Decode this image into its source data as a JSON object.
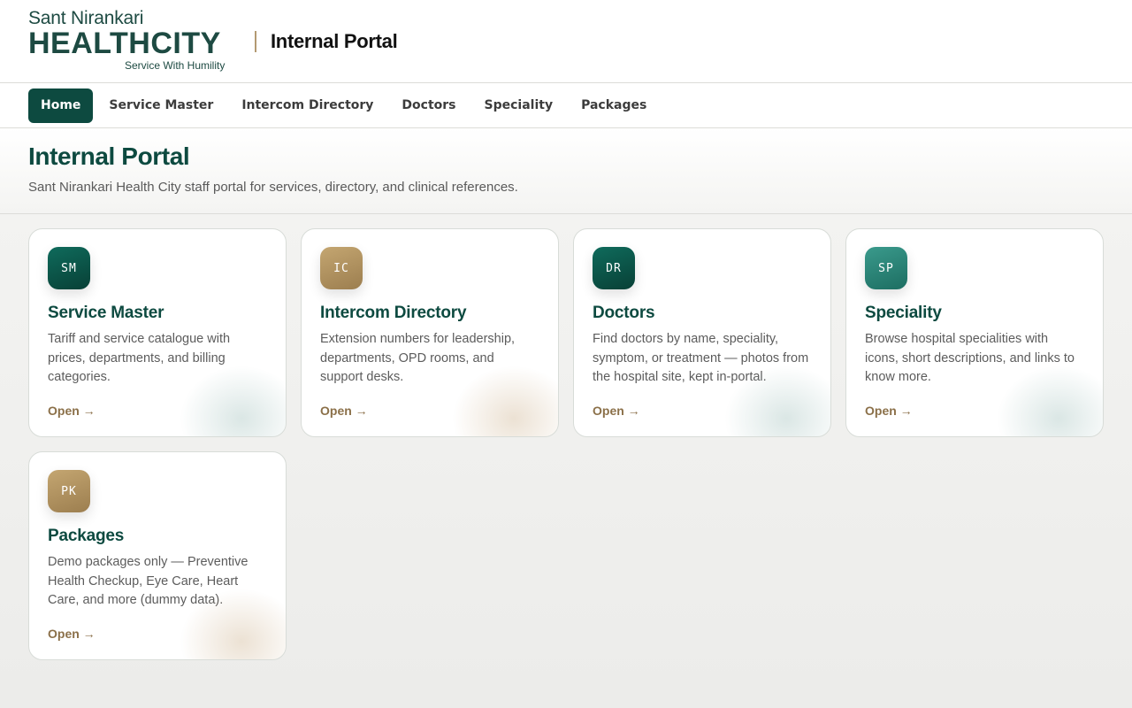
{
  "brand": {
    "line1": "Sant Nirankari",
    "line2": "HEALTHCITY",
    "tagline": "Service With Humility"
  },
  "header": {
    "title": "Internal Portal"
  },
  "nav": {
    "items": [
      {
        "label": "Home",
        "active": true
      },
      {
        "label": "Service Master",
        "active": false
      },
      {
        "label": "Intercom Directory",
        "active": false
      },
      {
        "label": "Doctors",
        "active": false
      },
      {
        "label": "Speciality",
        "active": false
      },
      {
        "label": "Packages",
        "active": false
      }
    ]
  },
  "hero": {
    "title": "Internal Portal",
    "subtitle": "Sant Nirankari Health City staff portal for services, directory, and clinical references."
  },
  "cards": [
    {
      "badge": "SM",
      "title": "Service Master",
      "desc": "Tariff and service catalogue with prices, departments, and billing categories.",
      "link": "Open →",
      "badge_color": "#0d5a4c"
    },
    {
      "badge": "IC",
      "title": "Intercom Directory",
      "desc": "Extension numbers for leadership, departments, OPD rooms, and support desks.",
      "link": "Open →",
      "badge_color": "#b39463"
    },
    {
      "badge": "DR",
      "title": "Doctors",
      "desc": "Find doctors by name, speciality, symptom, or treatment — photos from the hospital site, kept in-portal.",
      "link": "Open →",
      "badge_color": "#0d5a4c"
    },
    {
      "badge": "SP",
      "title": "Speciality",
      "desc": "Browse hospital specialities with icons, short descriptions, and links to know more.",
      "link": "Open →",
      "badge_color": "#2a8376"
    },
    {
      "badge": "PK",
      "title": "Packages",
      "desc": "Demo packages only — Preventive Health Checkup, Eye Care, Heart Care, and more (dummy data).",
      "link": "Open →",
      "badge_color": "#b39463"
    }
  ]
}
